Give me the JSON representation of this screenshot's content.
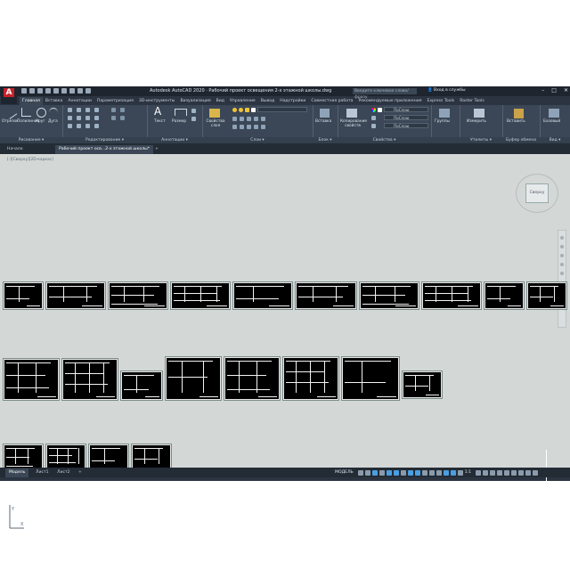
{
  "app": {
    "logo_letter": "A",
    "title": "Autodesk AutoCAD 2020 · Рабочий проект освещения 2-х этажной школы.dwg",
    "search_placeholder": "Введите ключевое слово/фразу",
    "sign_in": "Вход в службы",
    "window_controls": [
      "–",
      "□",
      "✕"
    ]
  },
  "ribbon_tabs": [
    "Главная",
    "Вставка",
    "Аннотации",
    "Параметризация",
    "3D-инструменты",
    "Визуализация",
    "Вид",
    "Управление",
    "Вывод",
    "Надстройки",
    "Совместная работа",
    "Рекомендуемые приложения",
    "Express Tools",
    "Raster Tools"
  ],
  "active_ribbon_tab": "Главная",
  "panels": {
    "draw": {
      "title": "Рисование ▾",
      "tools": [
        "Отрезок",
        "Полилиния",
        "Круг",
        "Дуга"
      ]
    },
    "modify": {
      "title": "Редактирование ▾"
    },
    "annotation": {
      "title": "Аннотации ▾",
      "tools": [
        "Текст",
        "Размер"
      ]
    },
    "layers": {
      "title": "Слои ▾",
      "tools": [
        "Свойства слоя"
      ]
    },
    "block": {
      "title": "Блок ▾",
      "tools": [
        "Вставка"
      ]
    },
    "properties": {
      "title": "Свойства ▾",
      "tools": [
        "Копирование свойств"
      ],
      "dropdowns": [
        "ПоСлою",
        "ПоСлою",
        "ПоСлою"
      ]
    },
    "groups": {
      "title": "",
      "tools": [
        "Группы"
      ]
    },
    "utilities": {
      "title": "Утилиты ▾",
      "tools": [
        "Измерить"
      ]
    },
    "clipboard": {
      "title": "Буфер обмена",
      "tools": [
        "Вставить"
      ]
    },
    "view": {
      "title": "Вид ▾",
      "tools": [
        "Базовый"
      ]
    }
  },
  "doc_tabs": [
    "Начало",
    "Рабочий проект осв...2-х этажной школы*",
    "+"
  ],
  "viewport_label": "[-][Сверху][2D-каркас]",
  "viewcube_label": "Сверху",
  "layout_tabs": [
    "Модель",
    "Лист1",
    "Лист2",
    "+"
  ],
  "status": {
    "model_label": "МОДЕЛЬ",
    "scale": "1:1"
  },
  "colors": {
    "accent": "#4a9fe0",
    "brand": "#c7222a",
    "canvas": "#d3d8d6",
    "chrome": "#2b3440"
  }
}
